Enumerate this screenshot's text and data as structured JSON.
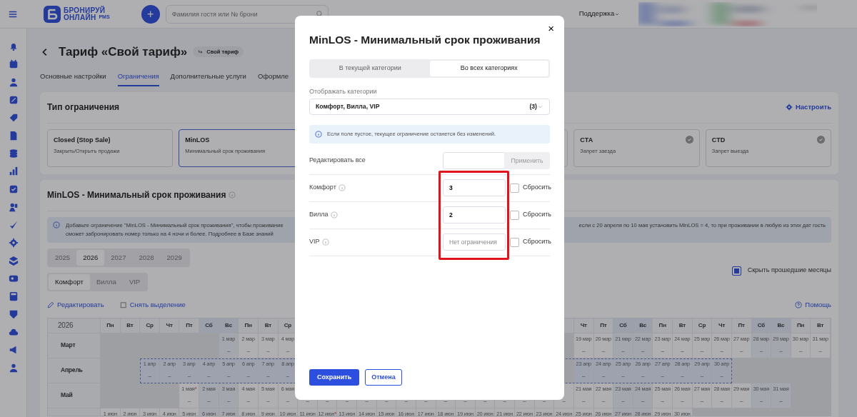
{
  "topbar": {
    "logo_line1": "БРОНИРУЙ",
    "logo_line2": "ОНЛАЙН",
    "logo_suffix": "PMS",
    "add_button": "+",
    "search": {
      "placeholder": "Фамилия гостя или № брони"
    },
    "support": "Поддержка"
  },
  "page": {
    "title": "Тариф «Свой тариф»",
    "badge": "Свой тариф",
    "tabs": [
      {
        "label": "Основные настройки",
        "selected": false
      },
      {
        "label": "Ограничения",
        "selected": true
      },
      {
        "label": "Дополнительные услуги",
        "selected": false
      },
      {
        "label": "Оформле",
        "selected": false
      }
    ]
  },
  "restriction_type": {
    "title": "Тип ограничения",
    "configure": "Настроить",
    "options": [
      {
        "kind": "card",
        "name": "Closed (Stop Sale)",
        "description": "Закрыть/Открыть продажи",
        "selected": false,
        "checkmark": false
      },
      {
        "kind": "card",
        "name": "MinLOS",
        "description": "Минимальный срок проживания",
        "selected": true,
        "checkmark": false
      },
      {
        "kind": "blank"
      },
      {
        "kind": "blank"
      },
      {
        "kind": "card",
        "name": "CTA",
        "description": "Запрет заезда",
        "selected": false,
        "checkmark": true
      },
      {
        "kind": "card",
        "name": "CTD",
        "description": "Запрет выезда",
        "selected": false,
        "checkmark": true
      }
    ]
  },
  "minlos": {
    "title": "MinLOS - Минимальный срок проживания",
    "info_left": "Добавьте ограничение \"MinLOS - Минимальный срок проживания\", чтобы проживание",
    "info_left_2": "сможет забронировать номер только на 4 ночи и более.",
    "info_link": "Подробнее в Базе знаний",
    "info_right": "если с 20 апреля по 10 мая установить MinLOS = 4, то при проживании в любую из этих дат гость",
    "years": [
      {
        "label": "2025",
        "selected": false
      },
      {
        "label": "2026",
        "selected": true
      },
      {
        "label": "2027",
        "selected": false
      },
      {
        "label": "2028",
        "selected": false
      },
      {
        "label": "2029",
        "selected": false
      }
    ],
    "categories": [
      {
        "label": "Комфорт",
        "selected": true
      },
      {
        "label": "Вилла",
        "selected": false
      },
      {
        "label": "VIP",
        "selected": false
      }
    ],
    "hide_past": {
      "label": "Скрыть прошедшие месяцы",
      "checked": true
    },
    "edit": "Редактировать",
    "deselect": "Снять выделение",
    "help": "Помощь",
    "calendar": {
      "year": "2026",
      "weekdays": [
        {
          "kind": "day",
          "label": "Пн",
          "weekend": false
        },
        {
          "kind": "day",
          "label": "Вт",
          "weekend": false
        },
        {
          "kind": "day",
          "label": "Ср",
          "weekend": false
        },
        {
          "kind": "day",
          "label": "Чт",
          "weekend": false
        },
        {
          "kind": "day",
          "label": "Пт",
          "weekend": false
        },
        {
          "kind": "day",
          "label": "Сб",
          "weekend": true
        },
        {
          "kind": "day",
          "label": "Вс",
          "weekend": true
        },
        {
          "kind": "day",
          "label": "Пн",
          "weekend": false
        },
        {
          "kind": "day",
          "label": "Вт",
          "weekend": false
        },
        {
          "kind": "day",
          "label": "Ср",
          "weekend": false
        },
        {
          "kind": "blank"
        },
        {
          "kind": "blank"
        },
        {
          "kind": "blank"
        },
        {
          "kind": "blank"
        },
        {
          "kind": "blank"
        },
        {
          "kind": "blank"
        },
        {
          "kind": "blank"
        },
        {
          "kind": "blank"
        },
        {
          "kind": "blank"
        },
        {
          "kind": "blank"
        },
        {
          "kind": "blank"
        },
        {
          "kind": "blank"
        },
        {
          "kind": "blank"
        },
        {
          "kind": "blank"
        },
        {
          "kind": "day",
          "label": "Чт",
          "weekend": false
        },
        {
          "kind": "day",
          "label": "Пт",
          "weekend": false
        },
        {
          "kind": "day",
          "label": "Сб",
          "weekend": true
        },
        {
          "kind": "day",
          "label": "Вс",
          "weekend": true
        },
        {
          "kind": "day",
          "label": "Пн",
          "weekend": false
        },
        {
          "kind": "day",
          "label": "Вт",
          "weekend": false
        },
        {
          "kind": "day",
          "label": "Ср",
          "weekend": false
        },
        {
          "kind": "day",
          "label": "Чт",
          "weekend": false
        },
        {
          "kind": "day",
          "label": "Пт",
          "weekend": false
        },
        {
          "kind": "day",
          "label": "Сб",
          "weekend": true
        },
        {
          "kind": "day",
          "label": "Вс",
          "weekend": true
        },
        {
          "kind": "day",
          "label": "Пн",
          "weekend": false
        },
        {
          "kind": "day",
          "label": "Вт",
          "weekend": false
        }
      ],
      "rows": [
        {
          "month": "Март",
          "cells": [
            {
              "kind": "blank"
            },
            {
              "kind": "blank"
            },
            {
              "kind": "blank"
            },
            {
              "kind": "blank"
            },
            {
              "kind": "blank"
            },
            {
              "kind": "blank"
            },
            {
              "kind": "day",
              "date": "1 мар",
              "value": "–",
              "selected": false
            },
            {
              "kind": "day",
              "date": "2 мар",
              "value": "–",
              "selected": false
            },
            {
              "kind": "day",
              "date": "3 мар",
              "value": "–",
              "selected": false
            },
            {
              "kind": "day",
              "date": "4 мар",
              "value": "–",
              "selected": false
            },
            {
              "kind": "blank"
            },
            {
              "kind": "blank"
            },
            {
              "kind": "blank"
            },
            {
              "kind": "blank"
            },
            {
              "kind": "blank"
            },
            {
              "kind": "blank"
            },
            {
              "kind": "blank"
            },
            {
              "kind": "blank"
            },
            {
              "kind": "blank"
            },
            {
              "kind": "blank"
            },
            {
              "kind": "blank"
            },
            {
              "kind": "blank"
            },
            {
              "kind": "blank"
            },
            {
              "kind": "blank"
            },
            {
              "kind": "day",
              "date": "19 мар",
              "value": "–",
              "selected": false
            },
            {
              "kind": "day",
              "date": "20 мар",
              "value": "–",
              "selected": false
            },
            {
              "kind": "day",
              "date": "21 мар",
              "value": "–",
              "selected": false
            },
            {
              "kind": "day",
              "date": "22 мар",
              "value": "–",
              "selected": false
            },
            {
              "kind": "day",
              "date": "23 мар",
              "value": "–",
              "selected": false
            },
            {
              "kind": "day",
              "date": "24 мар",
              "value": "–",
              "selected": false
            },
            {
              "kind": "day",
              "date": "25 мар",
              "value": "–",
              "selected": false
            },
            {
              "kind": "day",
              "date": "26 мар",
              "value": "–",
              "selected": false
            },
            {
              "kind": "day",
              "date": "27 мар",
              "value": "–",
              "selected": false
            },
            {
              "kind": "day",
              "date": "28 мар",
              "value": "–",
              "selected": false
            },
            {
              "kind": "day",
              "date": "29 мар",
              "value": "–",
              "selected": false
            },
            {
              "kind": "day",
              "date": "30 мар",
              "value": "–",
              "selected": false
            },
            {
              "kind": "day",
              "date": "31 мар",
              "value": "–",
              "selected": false
            }
          ]
        },
        {
          "month": "Апрель",
          "cells": [
            {
              "kind": "blank"
            },
            {
              "kind": "blank"
            },
            {
              "kind": "day",
              "date": "1 апр",
              "value": "–",
              "selected": true
            },
            {
              "kind": "day",
              "date": "2 апр",
              "value": "–",
              "selected": true
            },
            {
              "kind": "day",
              "date": "3 апр",
              "value": "–",
              "selected": true
            },
            {
              "kind": "day",
              "date": "4 апр",
              "value": "–",
              "selected": true
            },
            {
              "kind": "day",
              "date": "5 апр",
              "value": "–",
              "selected": true
            },
            {
              "kind": "day",
              "date": "6 апр",
              "value": "–",
              "selected": true
            },
            {
              "kind": "day",
              "date": "7 апр",
              "value": "–",
              "selected": true
            },
            {
              "kind": "day",
              "date": "8 апр",
              "value": "–",
              "selected": true
            },
            {
              "kind": "blank"
            },
            {
              "kind": "blank"
            },
            {
              "kind": "blank"
            },
            {
              "kind": "blank"
            },
            {
              "kind": "blank"
            },
            {
              "kind": "blank"
            },
            {
              "kind": "blank"
            },
            {
              "kind": "blank"
            },
            {
              "kind": "blank"
            },
            {
              "kind": "blank"
            },
            {
              "kind": "blank"
            },
            {
              "kind": "blank"
            },
            {
              "kind": "blank"
            },
            {
              "kind": "blank"
            },
            {
              "kind": "day",
              "date": "23 апр",
              "value": "–",
              "selected": true
            },
            {
              "kind": "day",
              "date": "24 апр",
              "value": "–",
              "selected": true
            },
            {
              "kind": "day",
              "date": "25 апр",
              "value": "–",
              "selected": true
            },
            {
              "kind": "day",
              "date": "26 апр",
              "value": "–",
              "selected": true
            },
            {
              "kind": "day",
              "date": "27 апр",
              "value": "–",
              "selected": true
            },
            {
              "kind": "day",
              "date": "28 апр",
              "value": "–",
              "selected": true
            },
            {
              "kind": "day",
              "date": "29 апр",
              "value": "–",
              "selected": true
            },
            {
              "kind": "day",
              "date": "30 апр",
              "value": "–",
              "selected": true
            },
            {
              "kind": "blank"
            },
            {
              "kind": "blank"
            },
            {
              "kind": "blank"
            },
            {
              "kind": "blank"
            },
            {
              "kind": "blank"
            }
          ]
        },
        {
          "month": "Май",
          "cells": [
            {
              "kind": "blank"
            },
            {
              "kind": "blank"
            },
            {
              "kind": "blank"
            },
            {
              "kind": "blank"
            },
            {
              "kind": "day",
              "date": "1 мая",
              "note": "*",
              "value": "–",
              "selected": false
            },
            {
              "kind": "day",
              "date": "2 мая",
              "value": "–",
              "selected": false
            },
            {
              "kind": "day",
              "date": "3 мая",
              "value": "–",
              "selected": false
            },
            {
              "kind": "day",
              "date": "4 мая",
              "value": "–",
              "selected": false
            },
            {
              "kind": "day",
              "date": "5 мая",
              "value": "–",
              "selected": false
            },
            {
              "kind": "day",
              "date": "6 мая",
              "value": "–",
              "selected": false
            },
            {
              "kind": "dash",
              "value": "–"
            },
            {
              "kind": "dash",
              "value": "–"
            },
            {
              "kind": "dash",
              "value": "–"
            },
            {
              "kind": "dash",
              "value": "–"
            },
            {
              "kind": "dash",
              "value": "–"
            },
            {
              "kind": "dash",
              "value": "–"
            },
            {
              "kind": "dash",
              "value": "–"
            },
            {
              "kind": "dash",
              "value": "–"
            },
            {
              "kind": "dash",
              "value": "–"
            },
            {
              "kind": "dash",
              "value": "–"
            },
            {
              "kind": "dash",
              "value": "–"
            },
            {
              "kind": "dash",
              "value": "–"
            },
            {
              "kind": "dash",
              "value": "–"
            },
            {
              "kind": "dash",
              "value": "–"
            },
            {
              "kind": "day",
              "date": "21 мая",
              "value": "–",
              "selected": false
            },
            {
              "kind": "day",
              "date": "22 мая",
              "value": "–",
              "selected": false
            },
            {
              "kind": "day",
              "date": "23 мая",
              "value": "–",
              "selected": false
            },
            {
              "kind": "day",
              "date": "24 мая",
              "value": "–",
              "selected": false
            },
            {
              "kind": "day",
              "date": "25 мая",
              "value": "–",
              "selected": false
            },
            {
              "kind": "day",
              "date": "26 мая",
              "value": "–",
              "selected": false
            },
            {
              "kind": "day",
              "date": "27 мая",
              "value": "–",
              "selected": false
            },
            {
              "kind": "day",
              "date": "28 мая",
              "value": "–",
              "selected": false
            },
            {
              "kind": "day",
              "date": "29 мая",
              "value": "–",
              "selected": false
            },
            {
              "kind": "day",
              "date": "30 мая",
              "value": "–",
              "selected": false
            },
            {
              "kind": "day",
              "date": "31 мая",
              "value": "–",
              "selected": false
            },
            {
              "kind": "blank"
            },
            {
              "kind": "blank"
            }
          ]
        },
        {
          "cells": [
            {
              "kind": "day",
              "date": "1 июн",
              "selected": false
            },
            {
              "kind": "day",
              "date": "2 июн",
              "selected": false
            },
            {
              "kind": "day",
              "date": "3 июн",
              "selected": false
            },
            {
              "kind": "day",
              "date": "4 июн",
              "selected": false
            },
            {
              "kind": "day",
              "date": "5 июн",
              "selected": false
            },
            {
              "kind": "day",
              "date": "6 июн",
              "selected": false
            },
            {
              "kind": "day",
              "date": "7 июн",
              "selected": false
            },
            {
              "kind": "day",
              "date": "8 июн",
              "selected": false
            },
            {
              "kind": "day",
              "date": "9 июн",
              "selected": false
            },
            {
              "kind": "day",
              "date": "10 июн",
              "selected": false
            },
            {
              "kind": "day",
              "date": "11 июн",
              "selected": false
            },
            {
              "kind": "day",
              "date": "12 июн",
              "note": "*",
              "selected": false
            },
            {
              "kind": "day",
              "date": "13 июн",
              "selected": false
            },
            {
              "kind": "day",
              "date": "14 июн",
              "selected": false
            },
            {
              "kind": "day",
              "date": "15 июн",
              "selected": false
            },
            {
              "kind": "day",
              "date": "16 июн",
              "selected": false
            },
            {
              "kind": "day",
              "date": "17 июн",
              "selected": false
            },
            {
              "kind": "day",
              "date": "18 июн",
              "selected": false
            },
            {
              "kind": "day",
              "date": "19 июн",
              "selected": false
            },
            {
              "kind": "day",
              "date": "20 июн",
              "selected": false
            },
            {
              "kind": "day",
              "date": "21 июн",
              "selected": false
            },
            {
              "kind": "day",
              "date": "22 июн",
              "selected": false
            },
            {
              "kind": "day",
              "date": "23 июн",
              "selected": false
            },
            {
              "kind": "day",
              "date": "24 июн",
              "selected": false
            },
            {
              "kind": "day",
              "date": "25 июн",
              "selected": false
            },
            {
              "kind": "day",
              "date": "26 июн",
              "selected": false
            },
            {
              "kind": "day",
              "date": "27 июн",
              "selected": false
            },
            {
              "kind": "day",
              "date": "28 июн",
              "selected": false
            },
            {
              "kind": "day",
              "date": "29 июн",
              "selected": false
            },
            {
              "kind": "day",
              "date": "30 июн",
              "selected": false
            },
            {
              "kind": "blank"
            },
            {
              "kind": "blank"
            },
            {
              "kind": "blank"
            },
            {
              "kind": "blank"
            },
            {
              "kind": "blank"
            },
            {
              "kind": "blank"
            },
            {
              "kind": "blank"
            }
          ]
        }
      ]
    }
  },
  "modal": {
    "title": "MinLOS - Минимальный срок проживания",
    "close": "×",
    "scope_tabs": [
      {
        "label": "В текущей категории",
        "selected": false
      },
      {
        "label": "Во всех категориях",
        "selected": true
      }
    ],
    "categories_label": "Отображать категории",
    "categories_value": "Комфорт, Вилла, VIP",
    "categories_count": "(3)",
    "notice": "Если поле пустое, текущее ограничение останется без изменений.",
    "edit_all": {
      "label": "Редактировать все",
      "button": "Применить"
    },
    "rows": [
      {
        "name": "Комфорт",
        "value": "3",
        "reset_label": "Сбросить",
        "reset": false
      },
      {
        "name": "Вилла",
        "value": "2",
        "reset_label": "Сбросить",
        "reset": false
      },
      {
        "name": "VIP",
        "placeholder": "Нет ограничения",
        "reset_label": "Сбросить",
        "reset": false
      }
    ],
    "highlighted": true,
    "save": "Сохранить",
    "cancel": "Отмена"
  }
}
